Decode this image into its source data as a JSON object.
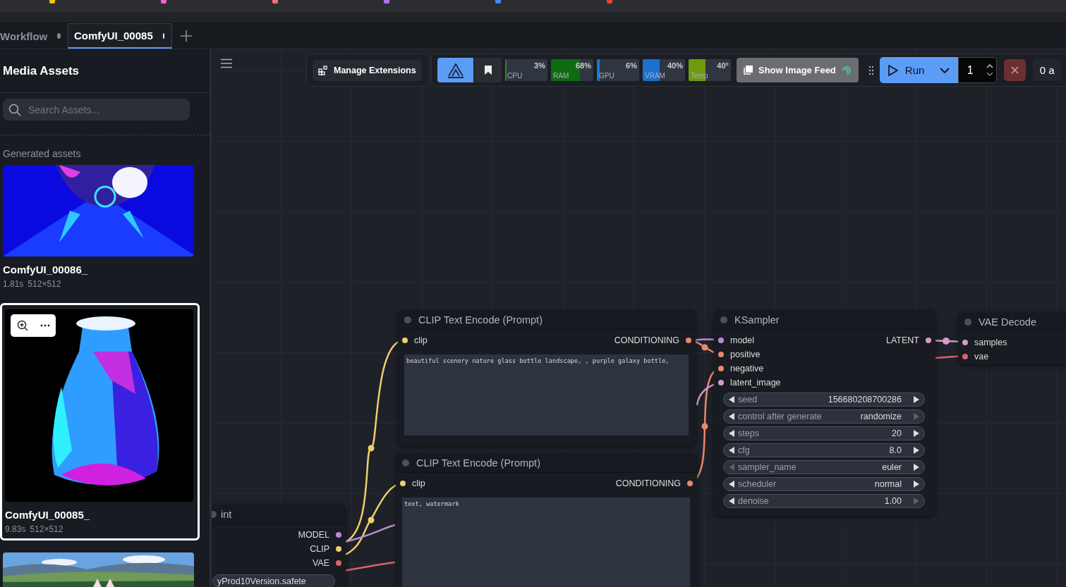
{
  "tabs": [
    {
      "label": "Workflow",
      "selected": false
    },
    {
      "label": "ComfyUI_00085",
      "selected": true
    }
  ],
  "sidebar": {
    "title": "Media Assets",
    "search": {
      "placeholder": "Search Assets..."
    },
    "section": "Generated assets",
    "assets": [
      {
        "name": "ComfyUI_00086_",
        "duration": "1.81s",
        "size": "512×512",
        "selected": false
      },
      {
        "name": "ComfyUI_00085_",
        "duration": "9.83s",
        "size": "512×512",
        "selected": true
      },
      {
        "selected": false
      }
    ]
  },
  "toolbar": {
    "extensions_button": "Manage Extensions",
    "meters": [
      {
        "label": "CPU",
        "reading": "3%",
        "level": 0.03,
        "color": "#1f8a2a"
      },
      {
        "label": "RAM",
        "reading": "68%",
        "level": 0.68,
        "color": "#0f6b12"
      },
      {
        "label": "GPU",
        "reading": "6%",
        "level": 0.06,
        "color": "#1d74d8"
      },
      {
        "label": "VRAM",
        "reading": "40%",
        "level": 0.4,
        "color": "#1d6fd0"
      },
      {
        "label": "Temp",
        "reading": "40°",
        "level": 0.4,
        "color": "#6e9a0c"
      }
    ],
    "image_feed_button": "Show Image Feed",
    "run_button": "Run",
    "batch_count": "1",
    "queue": "0 a"
  },
  "nodes": [
    {
      "kind": "text_encode",
      "title": "CLIP Text Encode (Prompt)",
      "inputs": [
        {
          "name": "clip",
          "color": "#f0cd6e"
        }
      ],
      "outputs": [
        {
          "name": "CONDITIONING",
          "color": "#e8896a"
        }
      ],
      "text": "beautiful scenery nature glass bottle landscape, , purple galaxy bottle,"
    },
    {
      "kind": "text_encode",
      "title": "CLIP Text Encode (Prompt)",
      "inputs": [
        {
          "name": "clip",
          "color": "#f0cd6e"
        }
      ],
      "outputs": [
        {
          "name": "CONDITIONING",
          "color": "#e8896a"
        }
      ],
      "text": "text, watermark"
    },
    {
      "kind": "sampler",
      "title": "KSampler",
      "inputs": [
        {
          "name": "model",
          "color": "#b48ed0"
        },
        {
          "name": "positive",
          "color": "#e8896a"
        },
        {
          "name": "negative",
          "color": "#e8896a"
        },
        {
          "name": "latent_image",
          "color": "#d59ac9"
        }
      ],
      "outputs": [
        {
          "name": "LATENT",
          "color": "#d59ac9"
        }
      ],
      "widgets": [
        {
          "label": "seed",
          "value": "156680208700286",
          "can_decrease": true,
          "can_increase": true
        },
        {
          "label": "control after generate",
          "value": "randomize",
          "can_decrease": true,
          "can_increase": false
        },
        {
          "label": "steps",
          "value": "20",
          "can_decrease": true,
          "can_increase": true
        },
        {
          "label": "cfg",
          "value": "8.0",
          "can_decrease": true,
          "can_increase": true
        },
        {
          "label": "sampler_name",
          "value": "euler",
          "can_decrease": false,
          "can_increase": true
        },
        {
          "label": "scheduler",
          "value": "normal",
          "can_decrease": true,
          "can_increase": true
        },
        {
          "label": "denoise",
          "value": "1.00",
          "can_decrease": true,
          "can_increase": false
        }
      ]
    },
    {
      "kind": "decode",
      "title": "VAE Decode",
      "inputs": [
        {
          "name": "samples",
          "color": "#d59ac9"
        },
        {
          "name": "vae",
          "color": "#e0616a"
        }
      ]
    },
    {
      "kind": "loader",
      "title": "int",
      "outputs": [
        {
          "name": "MODEL",
          "color": "#b48ed0"
        },
        {
          "name": "CLIP",
          "color": "#f0cd6e"
        },
        {
          "name": "VAE",
          "color": "#e0616a"
        }
      ],
      "widget_value": "yProd10Version.safete"
    }
  ]
}
